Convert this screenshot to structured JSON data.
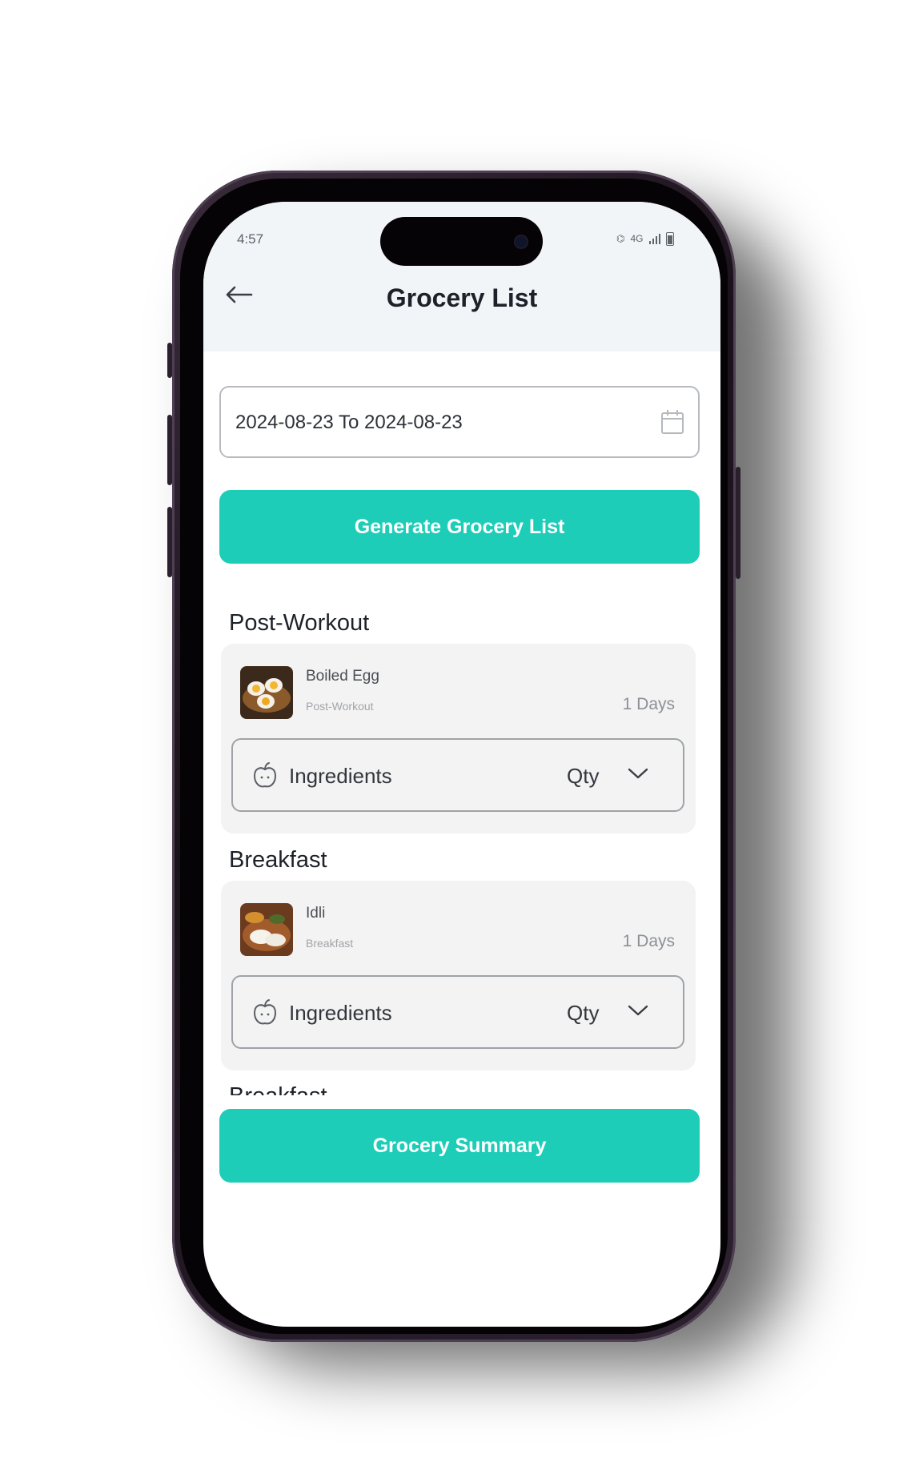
{
  "status_bar": {
    "time": "4:57",
    "network": "4G"
  },
  "header": {
    "title": "Grocery List"
  },
  "date_range": {
    "value": "2024-08-23 To 2024-08-23"
  },
  "actions": {
    "generate_label": "Generate Grocery List",
    "summary_label": "Grocery Summary"
  },
  "sections": [
    {
      "title": "Post-Workout",
      "item": {
        "name": "Boiled Egg",
        "meal": "Post-Workout",
        "days": "1 Days"
      },
      "ingredients_label": "Ingredients",
      "qty_label": "Qty"
    },
    {
      "title": "Breakfast",
      "item": {
        "name": "Idli",
        "meal": "Breakfast",
        "days": "1 Days"
      },
      "ingredients_label": "Ingredients",
      "qty_label": "Qty"
    },
    {
      "title": "Breakfast"
    }
  ],
  "colors": {
    "accent": "#1ecdb8",
    "header_bg": "#f2f5f8",
    "card_bg": "#f3f3f3"
  },
  "icons": [
    "back-arrow-icon",
    "calendar-icon",
    "apple-icon",
    "chevron-down-icon"
  ]
}
